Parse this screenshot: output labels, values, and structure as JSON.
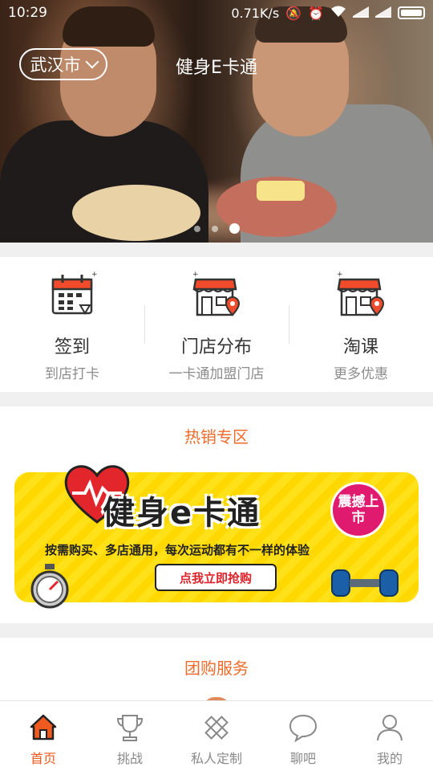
{
  "status_bar": {
    "time": "10:29",
    "net_speed": "0.71K/s"
  },
  "header": {
    "city": "武汉市",
    "title": "健身E卡通"
  },
  "carousel": {
    "slide_count": 3,
    "active_index": 2
  },
  "quick_entries": [
    {
      "label": "签到",
      "sub": "到店打卡",
      "icon": "calendar-checkin-icon"
    },
    {
      "label": "门店分布",
      "sub": "一卡通加盟门店",
      "icon": "store-location-icon"
    },
    {
      "label": "淘课",
      "sub": "更多优惠",
      "icon": "store-location-icon"
    }
  ],
  "hot_section": {
    "title": "热销专区",
    "banner": {
      "title": "健身e卡通",
      "badge": "震撼上市",
      "subtitle": "按需购买、多店通用，每次运动都有不一样的体验",
      "button": "点我立即抢购"
    }
  },
  "group_section": {
    "title": "团购服务"
  },
  "tab_bar": {
    "active_index": 0,
    "tabs": [
      {
        "label": "首页",
        "icon": "home-icon"
      },
      {
        "label": "挑战",
        "icon": "trophy-icon"
      },
      {
        "label": "私人定制",
        "icon": "pencil-ruler-icon"
      },
      {
        "label": "聊吧",
        "icon": "chat-bubble-icon"
      },
      {
        "label": "我的",
        "icon": "user-icon"
      }
    ]
  },
  "colors": {
    "accent": "#f05a1e",
    "section_title": "#f06b2b",
    "calendar_red": "#f04b2b"
  }
}
